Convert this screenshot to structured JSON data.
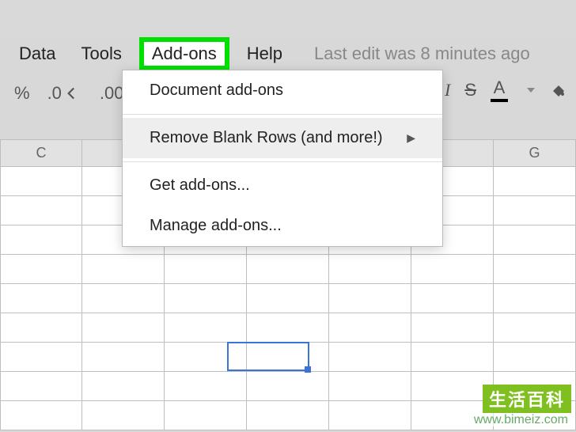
{
  "menu": {
    "data": "Data",
    "tools": "Tools",
    "addons": "Add-ons",
    "help": "Help"
  },
  "status": "Last edit was 8 minutes ago",
  "toolbar": {
    "percent": "%",
    "dec_less": ".0",
    "dec_more": ".00",
    "italic": "I",
    "strike": "S",
    "textcolor": "A"
  },
  "dropdown": {
    "doc_addons": "Document add-ons",
    "remove_blank": "Remove Blank Rows (and more!)",
    "get": "Get add-ons...",
    "manage": "Manage add-ons..."
  },
  "columns": [
    "C",
    "",
    "",
    "",
    "",
    "",
    "G"
  ],
  "watermark": {
    "badge": "生活百科",
    "url": "www.bimeiz.com"
  }
}
